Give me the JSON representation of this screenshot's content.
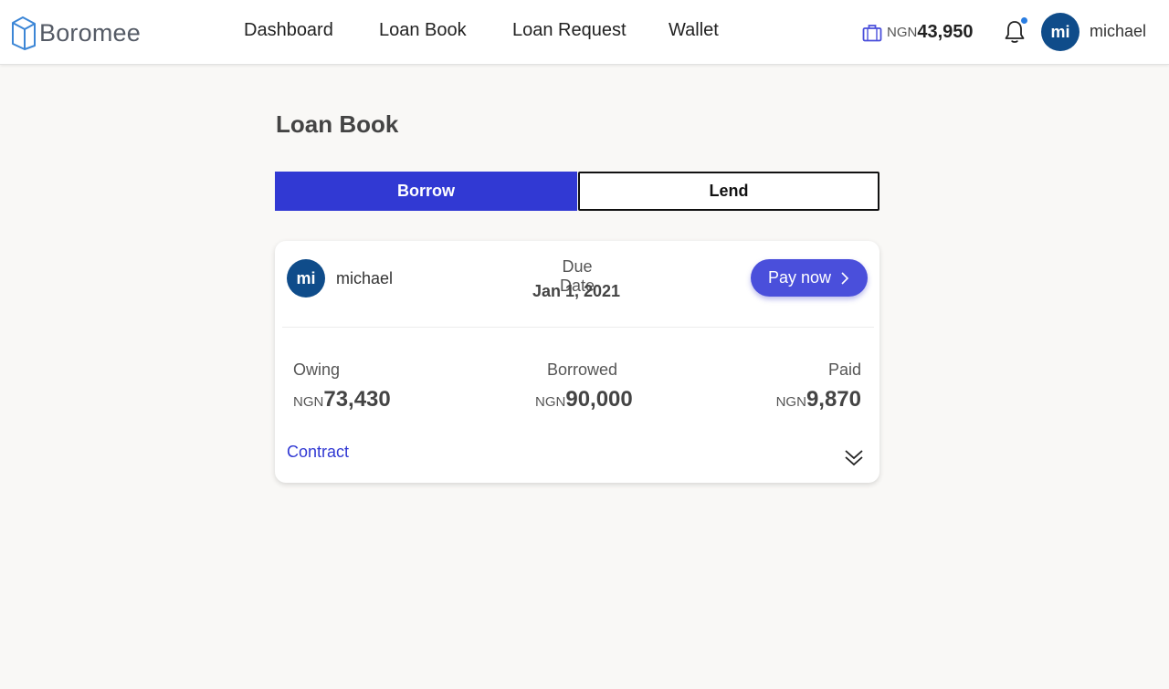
{
  "brand": {
    "name": "Boromee"
  },
  "nav": {
    "items": [
      "Dashboard",
      "Loan Book",
      "Loan Request",
      "Wallet"
    ]
  },
  "header": {
    "wallet_currency": "NGN",
    "wallet_amount": "43,950",
    "user_initials": "mi",
    "username": "michael"
  },
  "page": {
    "title": "Loan Book",
    "tabs": {
      "borrow": "Borrow",
      "lend": "Lend"
    },
    "active_tab": "Borrow"
  },
  "loan_card": {
    "initials": "mi",
    "name": "michael",
    "due_label": "Due Date",
    "due_date": "Jan 1, 2021",
    "pay_label": "Pay now",
    "owing": {
      "label": "Owing",
      "currency": "NGN",
      "amount": "73,430"
    },
    "borrowed": {
      "label": "Borrowed",
      "currency": "NGN",
      "amount": "90,000"
    },
    "paid": {
      "label": "Paid",
      "currency": "NGN",
      "amount": "9,870"
    },
    "contract_label": "Contract"
  },
  "colors": {
    "accent": "#3139d3",
    "pay_button": "#4a4fdb",
    "avatar": "#0f4c8a",
    "notification_dot": "#2a7de1",
    "background": "#f9f8f6"
  },
  "icons": {
    "logo": "boromee-box-logo",
    "wallet": "briefcase-icon",
    "bell": "bell-icon",
    "pay_chevron": "chevron-right-icon",
    "expand": "double-chevron-down-icon"
  }
}
